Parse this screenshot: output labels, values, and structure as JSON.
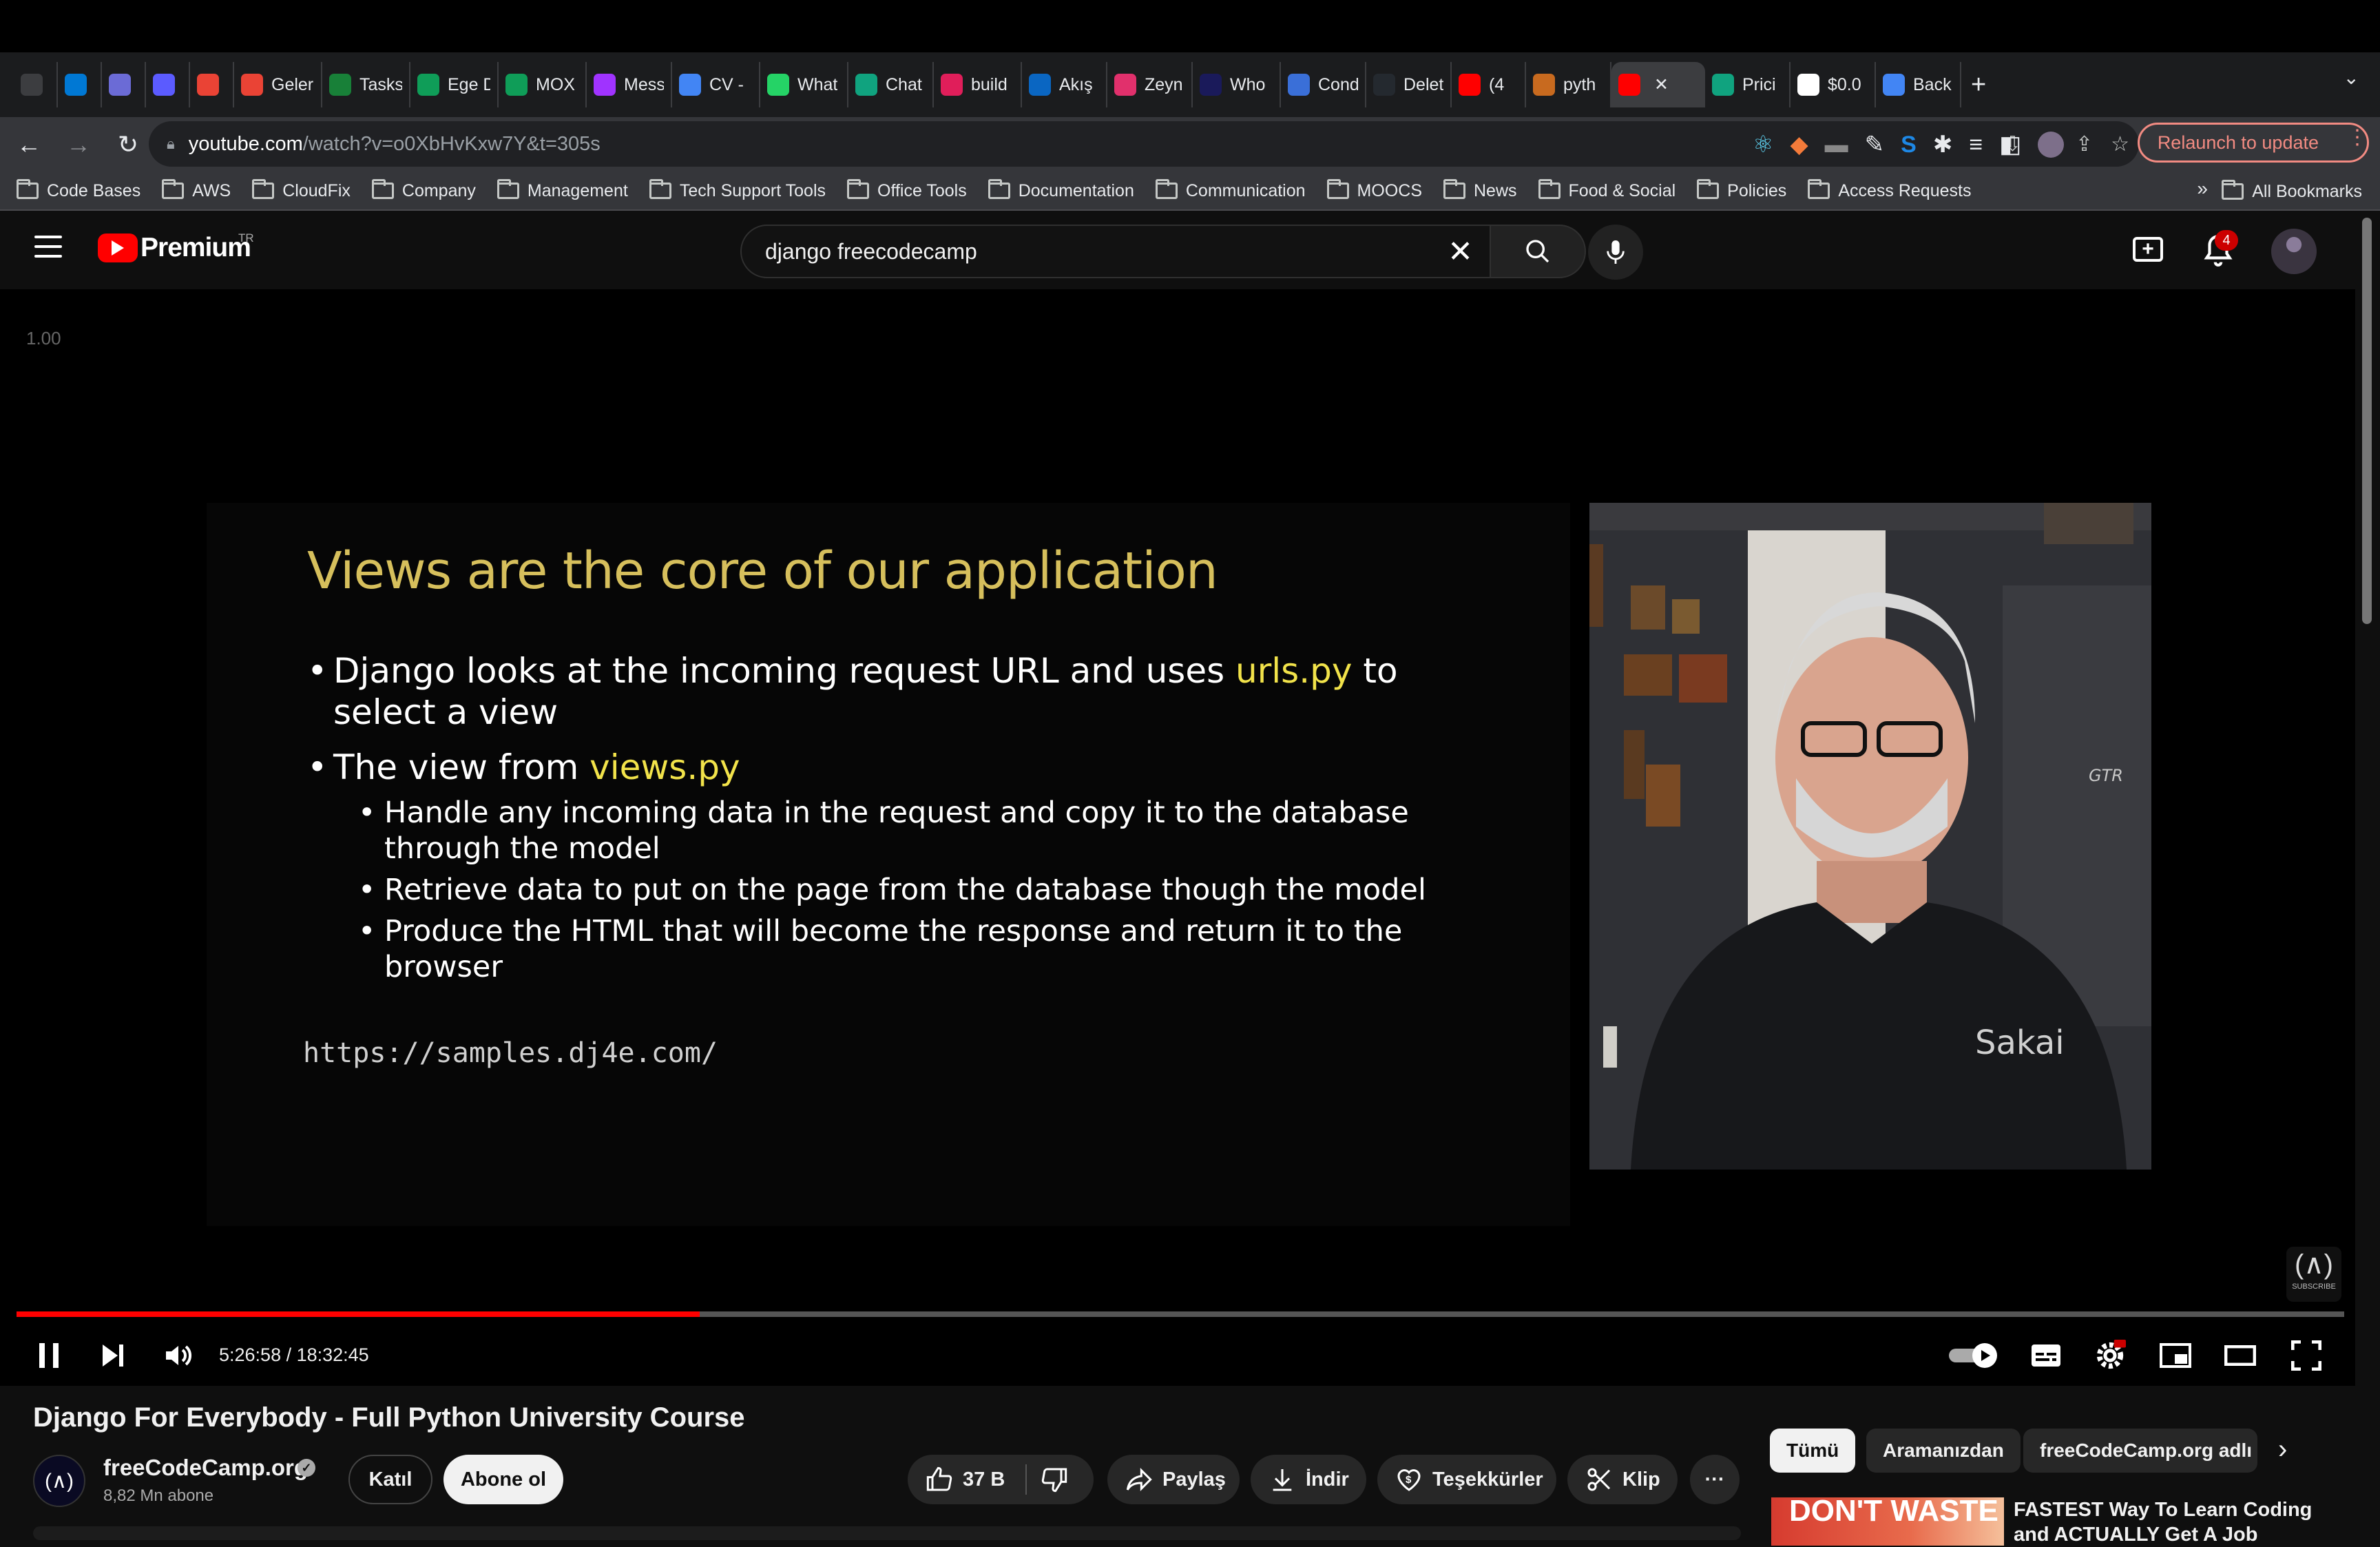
{
  "browser": {
    "tabs": [
      {
        "icon": "apps-icon",
        "label": "",
        "color": "#3c3d40"
      },
      {
        "icon": "outlook-icon",
        "label": "",
        "color": "#0078d4"
      },
      {
        "icon": "app-icon",
        "label": "",
        "color": "#6b6bd6"
      },
      {
        "icon": "app-icon",
        "label": "",
        "color": "#5b5bff"
      },
      {
        "icon": "gmail-icon",
        "label": "",
        "color": "#ea4335"
      },
      {
        "icon": "gmail-icon",
        "label": "Geler",
        "color": "#ea4335"
      },
      {
        "icon": "tasks-icon",
        "label": "Tasks",
        "color": "#188038"
      },
      {
        "icon": "sheets-icon",
        "label": "Ege D",
        "color": "#0f9d58"
      },
      {
        "icon": "sheets-icon",
        "label": "MOX",
        "color": "#0f9d58"
      },
      {
        "icon": "messenger-icon",
        "label": "Mess",
        "color": "#a033ff"
      },
      {
        "icon": "docs-icon",
        "label": "CV -",
        "color": "#4285f4"
      },
      {
        "icon": "whatsapp-icon",
        "label": "What",
        "color": "#25d366"
      },
      {
        "icon": "chatgpt-icon",
        "label": "Chat",
        "color": "#10a37f"
      },
      {
        "icon": "slack-icon",
        "label": "build",
        "color": "#e01e5a"
      },
      {
        "icon": "linkedin-icon",
        "label": "Akış",
        "color": "#0a66c2"
      },
      {
        "icon": "instagram-icon",
        "label": "Zeyn",
        "color": "#e1306c"
      },
      {
        "icon": "app-icon",
        "label": "Who",
        "color": "#1a1a5a"
      },
      {
        "icon": "app-icon",
        "label": "Cond",
        "color": "#3a6fd8"
      },
      {
        "icon": "github-icon",
        "label": "Delet",
        "color": "#24292f"
      },
      {
        "icon": "youtube-icon",
        "label": "(4",
        "color": "#ff0000"
      },
      {
        "icon": "python-icon",
        "label": "pyth",
        "color": "#c86a1f"
      },
      {
        "icon": "youtube-icon",
        "label": "",
        "color": "#ff0000",
        "active": true
      },
      {
        "icon": "chatgpt-icon",
        "label": "Prici",
        "color": "#10a37f"
      },
      {
        "icon": "google-icon",
        "label": "$0.0",
        "color": "#ffffff"
      },
      {
        "icon": "docs-icon",
        "label": "Back",
        "color": "#4285f4"
      }
    ],
    "url_host": "youtube.com",
    "url_path": "/watch?v=o0XbHvKxw7Y&t=305s",
    "relaunch_label": "Relaunch to update",
    "bookmarks": [
      "Code Bases",
      "AWS",
      "CloudFix",
      "Company",
      "Management",
      "Tech Support Tools",
      "Office Tools",
      "Documentation",
      "Communication",
      "MOOCS",
      "News",
      "Food & Social",
      "Policies",
      "Access Requests"
    ],
    "bookmarks_more": "»",
    "all_bookmarks": "All Bookmarks"
  },
  "youtube": {
    "logo_word": "Premium",
    "country": "TR",
    "search_value": "django freecodecamp",
    "notification_count": "4"
  },
  "player": {
    "speed_label": "1.00",
    "time_display": "5:26:58 / 18:32:45",
    "progress": 0.2935,
    "slide": {
      "title": "Views are the core of our application",
      "bullet1_pre": "Django looks at the incoming request URL and uses ",
      "bullet1_hl": "urls.py",
      "bullet1_post": " to select a view",
      "bullet2_pre": "The view from ",
      "bullet2_hl": "views.py",
      "sub1": "Handle any incoming data in the request and copy it to the database through the model",
      "sub2": "Retrieve data to put on the page from the database though the model",
      "sub3": "Produce the HTML that will become the response and return it to the browser",
      "url": "https://samples.dj4e.com/"
    },
    "webcam_shirt_text": "Sakai",
    "chair_text": "GTR",
    "watermark_text": "SUBSCRIBE"
  },
  "video": {
    "title": "Django For Everybody - Full Python University Course",
    "channel": "freeCodeCamp.org",
    "subscribers": "8,82 Mn abone",
    "join_label": "Katıl",
    "subscribe_label": "Abone ol",
    "likes": "37 B",
    "share_label": "Paylaş",
    "download_label": "İndir",
    "thanks_label": "Teşekkürler",
    "clip_label": "Klip",
    "more_label": "···"
  },
  "sidebar": {
    "chips": [
      "Tümü",
      "Aramanızdan",
      "freeCodeCamp.org adlı y"
    ],
    "rec_thumb_text": "DON'T WASTE",
    "rec_title": "FASTEST Way To Learn Coding and ACTUALLY Get A Job"
  }
}
